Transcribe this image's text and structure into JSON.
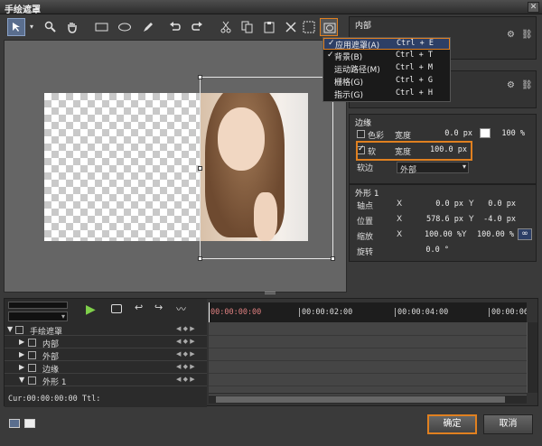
{
  "window": {
    "title": "手绘遮罩"
  },
  "menu": {
    "items": [
      {
        "checked": true,
        "label": "应用遮罩(A)",
        "shortcut": "Ctrl + E"
      },
      {
        "checked": true,
        "label": "背景(B)",
        "shortcut": "Ctrl + T"
      },
      {
        "checked": false,
        "label": "运动路径(M)",
        "shortcut": "Ctrl + M"
      },
      {
        "checked": false,
        "label": "栅格(G)",
        "shortcut": "Ctrl + G"
      },
      {
        "checked": false,
        "label": "指示(G)",
        "shortcut": "Ctrl + H"
      }
    ]
  },
  "inner": {
    "title": "内部"
  },
  "edge": {
    "title": "边缘",
    "color_label": "色彩",
    "width_label": "宽度",
    "width_value": "0.0 px",
    "opacity": "100 %",
    "soft_label": "软",
    "soft_width_label": "宽度",
    "soft_width_value": "100.0 px",
    "soft_edge_label": "软边",
    "soft_edge_value": "外部"
  },
  "shape": {
    "title": "外形 1",
    "pivot_label": "轴点",
    "pivot_x": "0.0 px",
    "pivot_y": "0.0 px",
    "position_label": "位置",
    "pos_x": "578.6 px",
    "pos_y": "-4.0 px",
    "scale_label": "缩放",
    "scale_x": "100.00 %",
    "scale_y": "100.00 %",
    "rotation_label": "旋转",
    "rotation_value": "0.0 °",
    "x_label": "X",
    "y_label": "Y"
  },
  "timeline": {
    "timecodes": [
      "00:00:00:00",
      "00:00:02:00",
      "00:00:04:00",
      "00:00:06:"
    ],
    "tracks": [
      {
        "label": "手绘遮罩"
      },
      {
        "label": "内部"
      },
      {
        "label": "外部"
      },
      {
        "label": "边缘"
      },
      {
        "label": "外形 1"
      }
    ],
    "status": "Cur:00:00:00:00 Ttl:"
  },
  "buttons": {
    "ok": "确定",
    "cancel": "取消"
  },
  "colors": {
    "accent": "#e08020",
    "selection": "#2d3f66",
    "background": "#3a3a3a"
  }
}
